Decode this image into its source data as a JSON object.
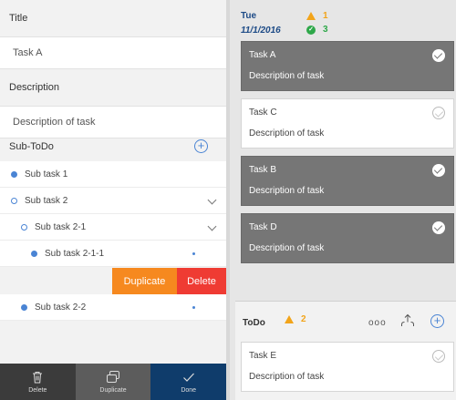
{
  "editor": {
    "title_label": "Title",
    "title_value": "Task A",
    "description_label": "Description",
    "description_value": "Description of task",
    "subtodo_label": "Sub-ToDo",
    "subtasks": [
      {
        "label": "Sub task 1"
      },
      {
        "label": "Sub task 2"
      },
      {
        "label": "Sub task 2-1"
      },
      {
        "label": "Sub task 2-1-1"
      },
      {
        "label": "Sub task 2-2"
      }
    ],
    "swipe_actions": {
      "duplicate": "Duplicate",
      "delete": "Delete"
    },
    "toolbar": {
      "delete": "Delete",
      "duplicate": "Duplicate",
      "done": "Done"
    }
  },
  "list": {
    "day": "Tue",
    "date": "11/1/2016",
    "warning_count": "1",
    "done_count": "3",
    "tasks": [
      {
        "title": "Task A",
        "description": "Description of task",
        "completed": true
      },
      {
        "title": "Task C",
        "description": "Description of task",
        "completed": false
      },
      {
        "title": "Task B",
        "description": "Description of task",
        "completed": true
      },
      {
        "title": "Task D",
        "description": "Description of task",
        "completed": true
      }
    ],
    "todo": {
      "title": "ToDo",
      "warning_count": "2",
      "more_icon": "ooo",
      "task": {
        "title": "Task E",
        "description": "Description of task"
      }
    }
  },
  "colors": {
    "accent": "#4a84d4",
    "duplicate": "#f6891f",
    "delete": "#ef3b33",
    "done_bar": "#0f3c6b",
    "warning": "#f2a41a",
    "success": "#2fa84a"
  }
}
